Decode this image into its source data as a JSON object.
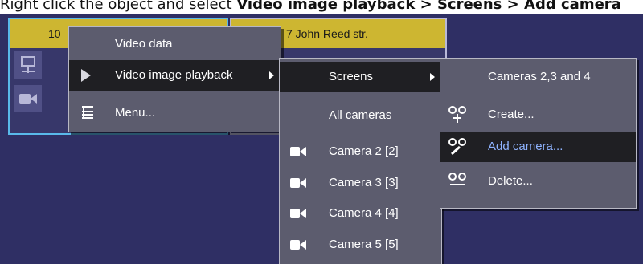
{
  "instruction": {
    "prefix": "Right click the object and select ",
    "step1": "Video image playback",
    "sep1": " > ",
    "step2": "Screens",
    "sep2": " > ",
    "step3": "Add camera"
  },
  "tiles": [
    {
      "title": "10"
    },
    {
      "title": "7 John Reed str."
    }
  ],
  "context_menu": {
    "items": [
      {
        "label": "Video data",
        "icon": "none"
      },
      {
        "label": "Video image playback",
        "icon": "play-triangle-icon",
        "has_submenu": true,
        "active": true
      },
      {
        "label": "Menu...",
        "icon": "menu-list-icon"
      }
    ]
  },
  "playback_menu": {
    "items": [
      {
        "label": "Screens",
        "has_submenu": true,
        "active": true
      },
      {
        "label": "All cameras"
      },
      {
        "label": "Camera 2 [2]",
        "icon": "camera-icon"
      },
      {
        "label": "Camera 3 [3]",
        "icon": "camera-icon"
      },
      {
        "label": "Camera 4 [4]",
        "icon": "camera-icon"
      },
      {
        "label": "Camera 5 [5]",
        "icon": "camera-icon"
      }
    ]
  },
  "screens_menu": {
    "items": [
      {
        "label": "Cameras 2,3 and 4"
      },
      {
        "label": "Create...",
        "icon": "screen-add-icon"
      },
      {
        "label": "Add camera...",
        "icon": "screen-edit-icon",
        "active": true
      },
      {
        "label": "Delete...",
        "icon": "screen-remove-icon"
      }
    ]
  },
  "colors": {
    "desktop": "#2f2f64",
    "tile_title": "#cdb631",
    "menu_bg": "#5c5c6e",
    "menu_active": "#1f1f23",
    "link_text": "#8fb3ff",
    "selection_border": "#59b9ea"
  }
}
